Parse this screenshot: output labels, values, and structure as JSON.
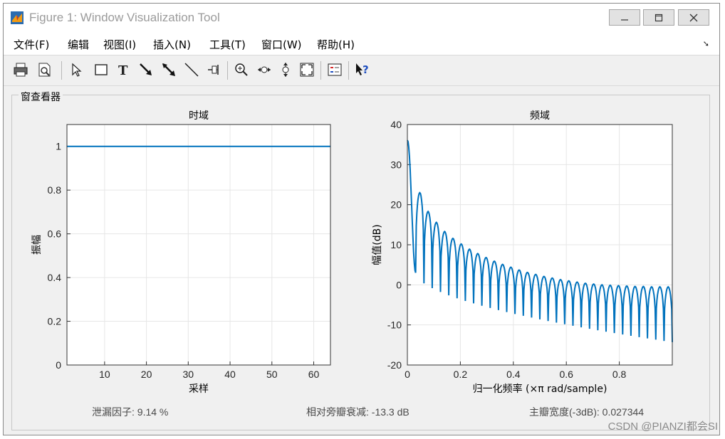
{
  "window": {
    "title": "Figure 1: Window Visualization Tool"
  },
  "menu": [
    "文件(F)",
    "编辑",
    "视图(I)",
    "插入(N)",
    "工具(T)",
    "窗口(W)",
    "帮助(H)"
  ],
  "toolbar": [
    {
      "icon": "print-icon"
    },
    {
      "icon": "print-preview-icon"
    },
    {
      "icon": "select-pointer-icon"
    },
    {
      "icon": "insert-rectangle-icon"
    },
    {
      "icon": "insert-text-icon"
    },
    {
      "icon": "insert-arrow-icon"
    },
    {
      "icon": "insert-double-arrow-icon"
    },
    {
      "icon": "insert-line-icon"
    },
    {
      "icon": "pin-icon"
    },
    {
      "icon": "zoom-in-icon"
    },
    {
      "icon": "pan-icon"
    },
    {
      "icon": "zoom-y-icon"
    },
    {
      "icon": "zoom-fit-icon"
    },
    {
      "icon": "legend-icon"
    },
    {
      "icon": "help-pointer-icon"
    }
  ],
  "panel": {
    "title": "窗查看器"
  },
  "chart_data": [
    {
      "type": "line",
      "title": "时域",
      "xlabel": "采样",
      "ylabel": "振幅",
      "xlim": [
        1,
        64
      ],
      "ylim": [
        0,
        1.1
      ],
      "xticks": [
        10,
        20,
        30,
        40,
        50,
        60
      ],
      "yticks": [
        0,
        0.2,
        0.4,
        0.6,
        0.8,
        1
      ],
      "grid": true,
      "series": [
        {
          "x": [
            1,
            64
          ],
          "y": [
            1,
            1
          ]
        }
      ]
    },
    {
      "type": "line",
      "title": "频域",
      "xlabel": "归一化频率 (×π rad/sample)",
      "ylabel": "幅值(dB)",
      "xlim": [
        0,
        1
      ],
      "ylim": [
        -20,
        40
      ],
      "xticks": [
        0,
        0.2,
        0.4,
        0.6,
        0.8
      ],
      "yticks": [
        -20,
        -10,
        0,
        10,
        20,
        30,
        40
      ],
      "grid": true,
      "mainlobe_peak_db": 36.1,
      "sidelobe_peaks_db": [
        23.0,
        18.3,
        15.6,
        13.3,
        11.6,
        10.2,
        8.9,
        7.8,
        6.8,
        5.9,
        5.1,
        4.4,
        3.7,
        3.1,
        2.6,
        2.1,
        1.7,
        1.3,
        1.0,
        0.7,
        0.4,
        0.2,
        0.0,
        -0.1,
        -0.2,
        -0.3,
        -0.4,
        -0.4,
        -0.5,
        -0.5,
        -0.5
      ],
      "null_floor_start_db": 3,
      "null_floor_end_db": -14
    }
  ],
  "footer": {
    "leakage": "泄漏因子: 9.14 %",
    "sidelobe": "相对旁瓣衰减: -13.3 dB",
    "mainlobe": "主瓣宽度(-3dB): 0.027344"
  },
  "watermark": "CSDN @PIANZI都会SI",
  "colors": {
    "line": "#0072bd",
    "grid": "#e6e6e6",
    "axes_bg": "#ffffff"
  }
}
